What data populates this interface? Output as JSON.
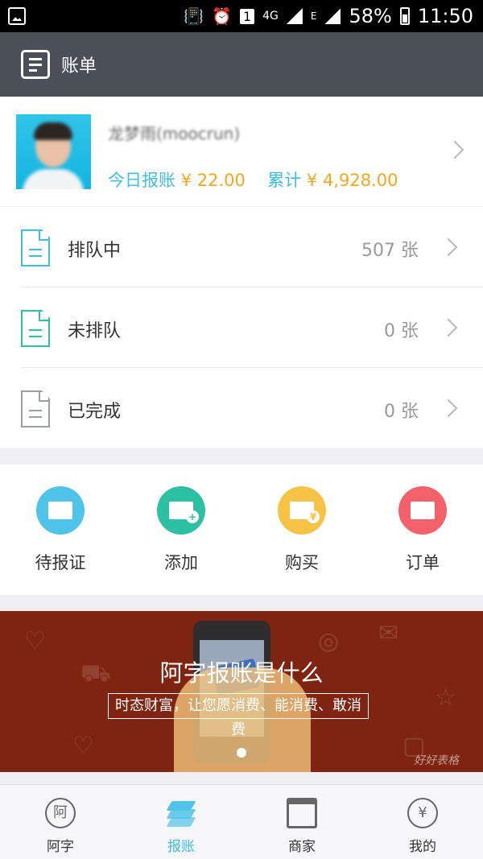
{
  "status_bar": {
    "network": "4G",
    "sim_slot": "1",
    "carrier_tag": "E",
    "battery": "58%",
    "time": "11:50"
  },
  "app_bar": {
    "title": "账单"
  },
  "profile": {
    "name": "龙梦雨(moocrun)",
    "today_label": "今日报账",
    "today_value": "¥ 22.00",
    "total_label": "累计",
    "total_value": "¥ 4,928.00"
  },
  "status_list": [
    {
      "label": "排队中",
      "count": "507 张",
      "color": "#40bde3"
    },
    {
      "label": "未排队",
      "count": "0 张",
      "color": "#2ec0a2"
    },
    {
      "label": "已完成",
      "count": "0 张",
      "color": "#9aa0a6"
    }
  ],
  "actions": [
    {
      "label": "待报证",
      "color": "#4fc3e8",
      "icon": "ticket-icon"
    },
    {
      "label": "添加",
      "color": "#2ec0a2",
      "icon": "ticket-add-icon"
    },
    {
      "label": "购买",
      "color": "#f7c346",
      "icon": "ticket-buy-icon"
    },
    {
      "label": "订单",
      "color": "#f3616b",
      "icon": "ticket-list-icon"
    }
  ],
  "banner": {
    "title": "阿字报账是什么",
    "subtitle": "时态财富，让您愿消费、能消费、敢消费",
    "logo": "好好表格"
  },
  "tabs": [
    {
      "label": "阿字",
      "glyph": "阿",
      "active": false
    },
    {
      "label": "报账",
      "active": true
    },
    {
      "label": "商家",
      "active": false
    },
    {
      "label": "我的",
      "glyph": "¥",
      "active": false
    }
  ]
}
